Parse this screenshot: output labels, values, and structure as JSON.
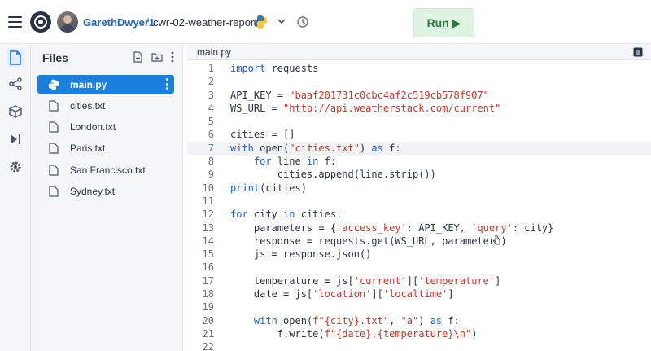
{
  "header": {
    "username": "GarethDwyer1",
    "separator": "/",
    "repl_name": "cwr-02-weather-report",
    "run_label": "Run ▶"
  },
  "sidebar_rail": {
    "icons": [
      "files-icon",
      "version-control-icon",
      "packages-icon",
      "debugger-icon",
      "settings-icon"
    ]
  },
  "files_panel": {
    "title": "Files",
    "items": [
      {
        "name": "main.py",
        "active": true,
        "icon": "python-icon"
      },
      {
        "name": "cities.txt",
        "active": false,
        "icon": "file-icon"
      },
      {
        "name": "London.txt",
        "active": false,
        "icon": "file-icon"
      },
      {
        "name": "Paris.txt",
        "active": false,
        "icon": "file-icon"
      },
      {
        "name": "San Francisco.txt",
        "active": false,
        "icon": "file-icon"
      },
      {
        "name": "Sydney.txt",
        "active": false,
        "icon": "file-icon"
      }
    ]
  },
  "editor": {
    "tab": "main.py",
    "lines": [
      "import requests",
      "",
      "API_KEY = \"baaf201731c0cbc4af2c519cb578f907\"",
      "WS_URL = \"http://api.weatherstack.com/current\"",
      "",
      "cities = []",
      "with open(\"cities.txt\") as f:",
      "    for line in f:",
      "        cities.append(line.strip())",
      "print(cities)",
      "",
      "for city in cities:",
      "    parameters = {'access_key': API_KEY, 'query': city}",
      "    response = requests.get(WS_URL, parameters)",
      "    js = response.json()",
      "",
      "    temperature = js['current']['temperature']",
      "    date = js['location']['localtime']",
      "",
      "    with open(f\"{city}.txt\", \"a\") as f:",
      "        f.write(f\"{date},{temperature}\\n\")",
      ""
    ],
    "highlighted_line": 7
  },
  "colors": {
    "accent": "#1b7fde",
    "run_bg": "#dff3e3",
    "run_text": "#2f7a3e",
    "keyword": "#1b5fd6",
    "string": "#c0392b"
  }
}
